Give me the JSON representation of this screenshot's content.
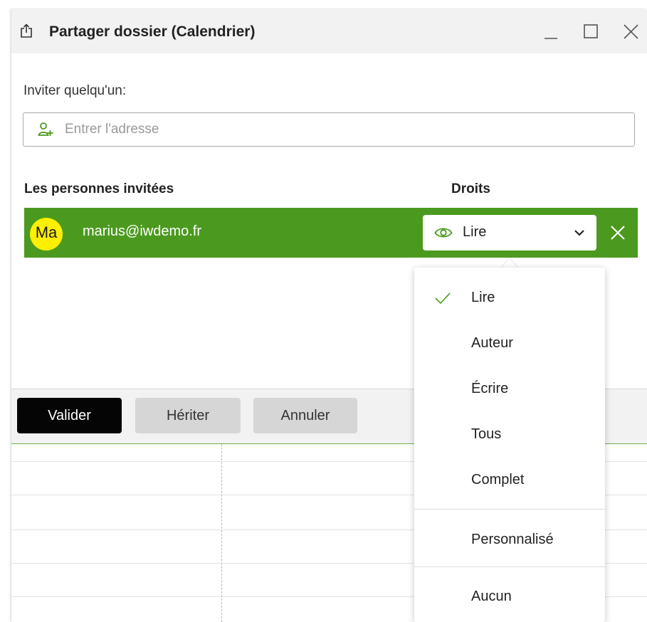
{
  "window": {
    "title": "Partager dossier (Calendrier)",
    "minimize_glyph": "_",
    "maximize_icon": "maximize-icon",
    "close_icon": "close-icon"
  },
  "invite": {
    "label": "Inviter quelqu'un:",
    "placeholder": "Entrer l'adresse",
    "value": "",
    "icon": "add-user-icon"
  },
  "table": {
    "people_header": "Les personnes invitées",
    "rights_header": "Droits",
    "rows": [
      {
        "avatar_initials": "Ma",
        "email": "marius@iwdemo.fr",
        "rights": "Lire",
        "rights_icon": "eye-icon",
        "selected": true
      }
    ]
  },
  "actions": {
    "validate": "Valider",
    "inherit": "Hériter",
    "cancel": "Annuler"
  },
  "rights_menu": {
    "selected": "Lire",
    "items": [
      "Lire",
      "Auteur",
      "Écrire",
      "Tous",
      "Complet"
    ],
    "custom": "Personnalisé",
    "none": "Aucun"
  },
  "colors": {
    "accent_green": "#4b9a1f",
    "avatar_yellow": "#ffef00",
    "primary_button": "#050505",
    "secondary_button": "#d6d6d6"
  }
}
